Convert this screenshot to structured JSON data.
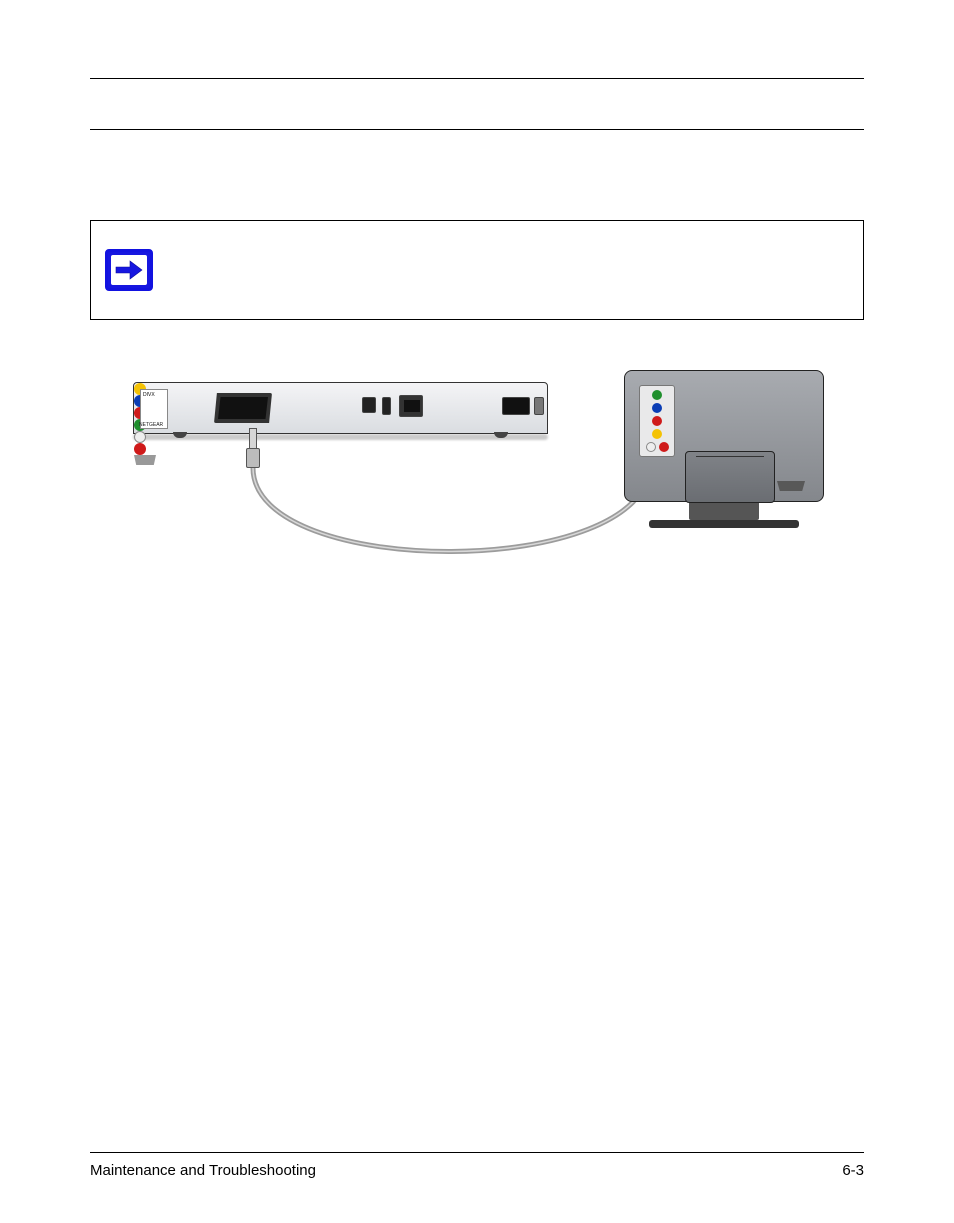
{
  "header": {
    "rule1": true,
    "rule2": true
  },
  "device": {
    "brand_label": "NETGEAR",
    "tag_text": "DIVX"
  },
  "footer": {
    "section": "Maintenance and Troubleshooting",
    "page": "6-3"
  }
}
